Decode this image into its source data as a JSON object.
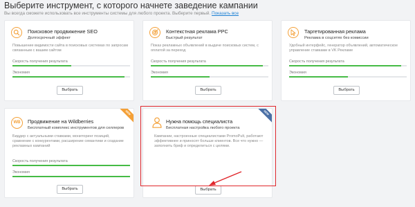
{
  "page": {
    "title": "Выберите инструмент, с которого начнете заведение кампании",
    "subtitle_prefix": "Вы всегда сможете использовать все инструменты системы для любого проекта. Выберите первый. ",
    "subtitle_link": "Показать все"
  },
  "metrics": {
    "speed_label": "Скорость получения результата",
    "economy_label": "Экономия"
  },
  "button_label": "Выбрать",
  "colors": {
    "accent": "#f4a037",
    "bar_fill": "#45bb45",
    "highlight": "#e0262b",
    "link": "#1a7fd4"
  },
  "cards": [
    {
      "icon": "search-icon",
      "title": "Поисковое продвижение SEO",
      "subtitle": "Долгосрочный эффект",
      "description": "Повышение видимости сайта в поисковых системах по запросам связанным с вашим сайтом",
      "speed": 0.5,
      "economy": 0.95
    },
    {
      "icon": "target-icon",
      "title": "Контекстная реклама PPC",
      "subtitle": "Быстрый результат",
      "description": "Показ рекламных объявлений в выдаче поисковых систем, с оплатой за переход",
      "speed": 0.95,
      "economy": 0.5
    },
    {
      "icon": "cursor-icon",
      "title": "Таргетированная реклама",
      "subtitle": "Реклама в соцсетях без комиссии",
      "description": "Удобный интерфейс, генератор объявлений, автоматическое управление ставками в VK Рекламе",
      "speed": 0.95,
      "economy": 0.5
    },
    {
      "icon": "wb-icon",
      "icon_text": "WB",
      "ribbon": "NEW",
      "title": "Продвижение на Wildberries",
      "subtitle": "Бесплатный комплекс инструментов для селлеров",
      "description": "Биддер с актуальными ставками, мониторинг позиций, сравнение с конкурентами, расширение семантики и создание рекламных кампаний",
      "speed": 1.0,
      "economy": 1.0
    },
    {
      "icon": "person-icon",
      "ribbon": "NEW",
      "title": "Нужна помощь специалиста",
      "subtitle": "Бесплатная настройка любого проекта",
      "description": "Кампании, настроенные специалистами PromoPult, работают эффективнее и приносят больше клиентов. Все что нужно — заполнить бриф и определиться с целями."
    }
  ]
}
